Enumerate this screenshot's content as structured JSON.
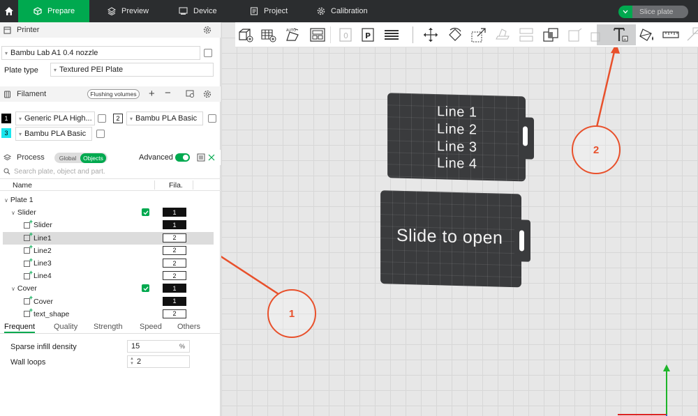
{
  "topbar": {
    "tabs": [
      {
        "label": "Prepare"
      },
      {
        "label": "Preview"
      },
      {
        "label": "Device"
      },
      {
        "label": "Project"
      },
      {
        "label": "Calibration"
      }
    ],
    "slice_button": "Slice plate"
  },
  "printer": {
    "title": "Printer",
    "model": "Bambu Lab A1 0.4 nozzle",
    "plate_type_label": "Plate type",
    "plate_type": "Textured PEI Plate"
  },
  "filament": {
    "title": "Filament",
    "flushing_label": "Flushing volumes",
    "slots": [
      {
        "num": "1",
        "name": "Generic PLA High...",
        "color": "#000000"
      },
      {
        "num": "2",
        "name": "Bambu PLA Basic",
        "color": "#ffffff"
      },
      {
        "num": "3",
        "name": "Bambu PLA Basic",
        "color": "#19e6ee"
      }
    ]
  },
  "process": {
    "title": "Process",
    "toggle_global": "Global",
    "toggle_objects": "Objects",
    "advanced_label": "Advanced",
    "search_placeholder": "Search plate, object and part.",
    "col_name": "Name",
    "col_fila": "Fila."
  },
  "tree": [
    {
      "label": "Plate 1",
      "fila": "",
      "indent": 0,
      "expand": true,
      "check": false,
      "icon": false
    },
    {
      "label": "Slider",
      "fila": "1",
      "indent": 1,
      "expand": true,
      "check": true,
      "icon": false
    },
    {
      "label": "Slider",
      "fila": "1",
      "indent": 2,
      "expand": false,
      "check": false,
      "icon": true
    },
    {
      "label": "Line1",
      "fila": "2",
      "indent": 2,
      "expand": false,
      "check": false,
      "icon": true,
      "selected": true
    },
    {
      "label": "Line2",
      "fila": "2",
      "indent": 2,
      "expand": false,
      "check": false,
      "icon": true
    },
    {
      "label": "Line3",
      "fila": "2",
      "indent": 2,
      "expand": false,
      "check": false,
      "icon": true
    },
    {
      "label": "Line4",
      "fila": "2",
      "indent": 2,
      "expand": false,
      "check": false,
      "icon": true
    },
    {
      "label": "Cover",
      "fila": "1",
      "indent": 1,
      "expand": true,
      "check": true,
      "icon": false
    },
    {
      "label": "Cover",
      "fila": "1",
      "indent": 2,
      "expand": false,
      "check": false,
      "icon": true
    },
    {
      "label": "text_shape",
      "fila": "2",
      "indent": 2,
      "expand": false,
      "check": false,
      "icon": true
    }
  ],
  "param_tabs": [
    "Frequent",
    "Quality",
    "Strength",
    "Speed",
    "Others"
  ],
  "params": {
    "sparse_label": "Sparse infill density",
    "sparse_value": "15",
    "sparse_unit": "%",
    "wall_label": "Wall loops",
    "wall_value": "2"
  },
  "plates": {
    "top_lines": [
      "Line 1",
      "Line 2",
      "Line 3",
      "Line 4"
    ],
    "bottom_text": "Slide to open"
  },
  "callouts": [
    "1",
    "2"
  ],
  "colors": {
    "accent": "#00a94f",
    "annotation": "#e8502b",
    "topbar": "#2b2d2f"
  }
}
